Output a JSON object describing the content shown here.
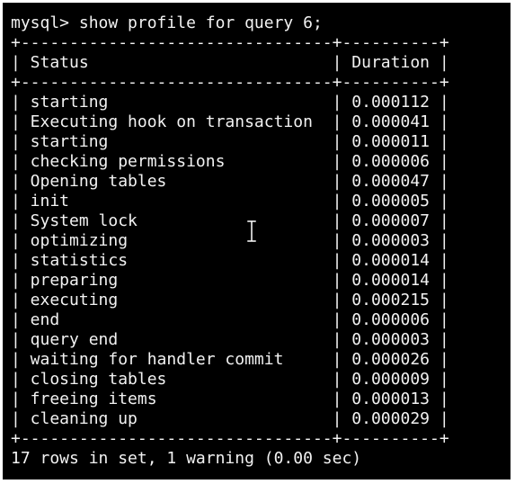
{
  "terminal": {
    "prompt": "mysql> show profile for query 6;",
    "border": "+--------------------------------+----------+",
    "header": "| Status                         | Duration |",
    "rows": [
      "| starting                       | 0.000112 |",
      "| Executing hook on transaction  | 0.000041 |",
      "| starting                       | 0.000011 |",
      "| checking permissions           | 0.000006 |",
      "| Opening tables                 | 0.000047 |",
      "| init                           | 0.000005 |",
      "| System lock                    | 0.000007 |",
      "| optimizing                     | 0.000003 |",
      "| statistics                     | 0.000014 |",
      "| preparing                      | 0.000014 |",
      "| executing                      | 0.000215 |",
      "| end                            | 0.000006 |",
      "| query end                      | 0.000003 |",
      "| waiting for handler commit     | 0.000026 |",
      "| closing tables                 | 0.000009 |",
      "| freeing items                  | 0.000013 |",
      "| cleaning up                    | 0.000029 |"
    ],
    "summary": "17 rows in set, 1 warning (0.00 sec)"
  },
  "colors": {
    "background": "#000000",
    "text": "#f2f2f2"
  },
  "icons": {
    "cursor": "text-cursor-icon"
  }
}
